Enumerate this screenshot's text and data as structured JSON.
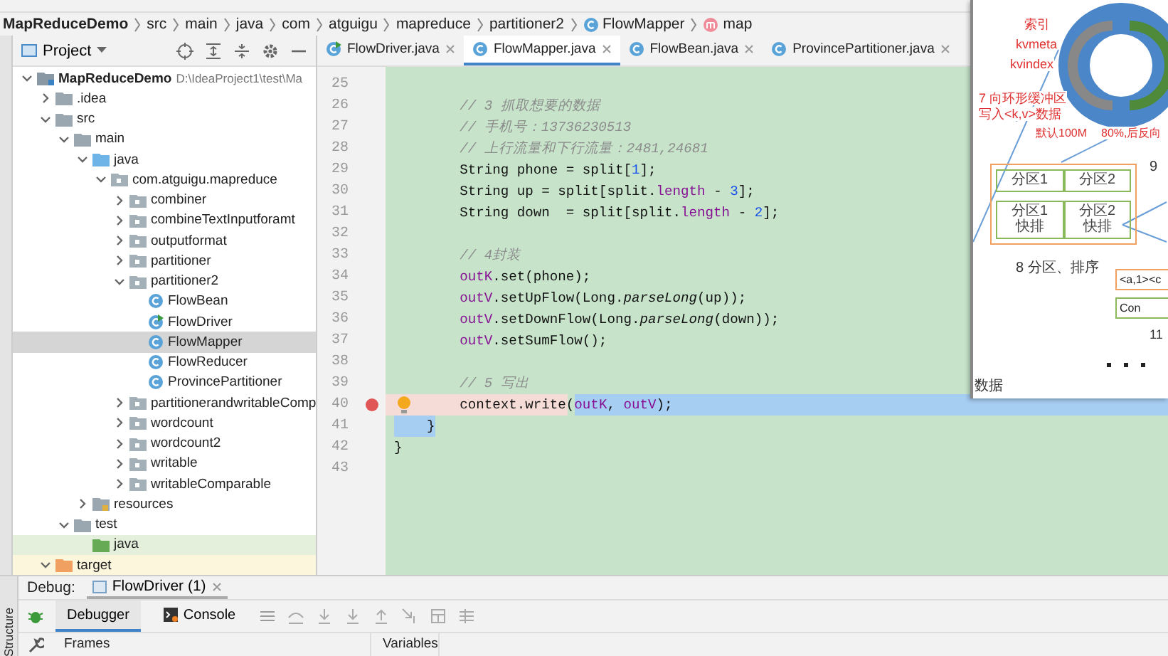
{
  "breadcrumbs": [
    {
      "text": "MapReduceDemo",
      "kind": "project"
    },
    {
      "text": "src",
      "kind": "folder"
    },
    {
      "text": "main",
      "kind": "folder"
    },
    {
      "text": "java",
      "kind": "folder"
    },
    {
      "text": "com",
      "kind": "folder"
    },
    {
      "text": "atguigu",
      "kind": "folder"
    },
    {
      "text": "mapreduce",
      "kind": "folder"
    },
    {
      "text": "partitioner2",
      "kind": "folder"
    },
    {
      "text": "FlowMapper",
      "kind": "class"
    },
    {
      "text": "map",
      "kind": "method"
    }
  ],
  "project_panel": {
    "title": "Project"
  },
  "tree": [
    {
      "label": "MapReduceDemo",
      "hint": "D:\\IdeaProject1\\test\\Ma",
      "kind": "module",
      "expanded": true,
      "selected": false,
      "children": [
        {
          "label": ".idea",
          "kind": "folder",
          "expanded": false,
          "selected": false
        },
        {
          "label": "src",
          "kind": "folder",
          "expanded": true,
          "selected": false,
          "children": [
            {
              "label": "main",
              "kind": "folder",
              "expanded": true,
              "selected": false,
              "children": [
                {
                  "label": "java",
                  "kind": "source",
                  "expanded": true,
                  "selected": false,
                  "children": [
                    {
                      "label": "com.atguigu.mapreduce",
                      "kind": "package",
                      "expanded": true,
                      "selected": false,
                      "children": [
                        {
                          "label": "combiner",
                          "kind": "package",
                          "expanded": false,
                          "selected": false
                        },
                        {
                          "label": "combineTextInputforamt",
                          "kind": "package",
                          "expanded": false,
                          "selected": false
                        },
                        {
                          "label": "outputformat",
                          "kind": "package",
                          "expanded": false,
                          "selected": false
                        },
                        {
                          "label": "partitioner",
                          "kind": "package",
                          "expanded": false,
                          "selected": false
                        },
                        {
                          "label": "partitioner2",
                          "kind": "package",
                          "expanded": true,
                          "selected": false,
                          "children": [
                            {
                              "label": "FlowBean",
                              "kind": "class",
                              "selected": false
                            },
                            {
                              "label": "FlowDriver",
                              "kind": "runnable-class",
                              "selected": false
                            },
                            {
                              "label": "FlowMapper",
                              "kind": "class",
                              "selected": true
                            },
                            {
                              "label": "FlowReducer",
                              "kind": "class",
                              "selected": false
                            },
                            {
                              "label": "ProvincePartitioner",
                              "kind": "class",
                              "selected": false
                            }
                          ]
                        },
                        {
                          "label": "partitionerandwritableComp",
                          "kind": "package",
                          "expanded": false,
                          "selected": false
                        },
                        {
                          "label": "wordcount",
                          "kind": "package",
                          "expanded": false,
                          "selected": false
                        },
                        {
                          "label": "wordcount2",
                          "kind": "package",
                          "expanded": false,
                          "selected": false
                        },
                        {
                          "label": "writable",
                          "kind": "package",
                          "expanded": false,
                          "selected": false
                        },
                        {
                          "label": "writableComparable",
                          "kind": "package",
                          "expanded": false,
                          "selected": false
                        }
                      ]
                    }
                  ]
                },
                {
                  "label": "resources",
                  "kind": "resources",
                  "expanded": false,
                  "selected": false
                }
              ]
            },
            {
              "label": "test",
              "kind": "folder",
              "expanded": true,
              "selected": false,
              "children": [
                {
                  "label": "java",
                  "kind": "test-source",
                  "selected": false
                }
              ]
            }
          ]
        },
        {
          "label": "target",
          "kind": "excluded",
          "expanded": true,
          "selected": false
        }
      ]
    }
  ],
  "editor_tabs": [
    {
      "label": "FlowDriver.java",
      "kind": "runnable-class",
      "selected": false
    },
    {
      "label": "FlowMapper.java",
      "kind": "class",
      "selected": true
    },
    {
      "label": "FlowBean.java",
      "kind": "class",
      "selected": false
    },
    {
      "label": "ProvincePartitioner.java",
      "kind": "class",
      "selected": false
    }
  ],
  "code_lines": [
    {
      "number": "25"
    },
    {
      "number": "26",
      "segments": [
        {
          "text": "        // 3 抓取想要的数据",
          "kind": "comment",
          "selected": false
        }
      ]
    },
    {
      "number": "27",
      "segments": [
        {
          "text": "        // 手机号：13736230513",
          "kind": "comment",
          "selected": false
        }
      ]
    },
    {
      "number": "28",
      "segments": [
        {
          "text": "        // 上行流量和下行流量：2481,24681",
          "kind": "comment",
          "selected": false
        }
      ]
    },
    {
      "number": "29",
      "segments": [
        {
          "text": "        String phone = split[",
          "kind": "plain",
          "selected": false
        },
        {
          "text": "1",
          "kind": "number",
          "selected": false
        },
        {
          "text": "];",
          "kind": "plain",
          "selected": false
        }
      ]
    },
    {
      "number": "30",
      "segments": [
        {
          "text": "        String up = split[split.",
          "kind": "plain",
          "selected": false
        },
        {
          "text": "length",
          "kind": "field",
          "selected": false
        },
        {
          "text": " - ",
          "kind": "plain",
          "selected": false
        },
        {
          "text": "3",
          "kind": "number",
          "selected": false
        },
        {
          "text": "];",
          "kind": "plain",
          "selected": false
        }
      ]
    },
    {
      "number": "31",
      "segments": [
        {
          "text": "        String down  = split[split.",
          "kind": "plain",
          "selected": false
        },
        {
          "text": "length",
          "kind": "field",
          "selected": false
        },
        {
          "text": " - ",
          "kind": "plain",
          "selected": false
        },
        {
          "text": "2",
          "kind": "number",
          "selected": false
        },
        {
          "text": "];",
          "kind": "plain",
          "selected": false
        }
      ]
    },
    {
      "number": "32"
    },
    {
      "number": "33",
      "segments": [
        {
          "text": "        // 4封装",
          "kind": "comment",
          "selected": false
        }
      ]
    },
    {
      "number": "34",
      "segments": [
        {
          "text": "        outK",
          "kind": "field",
          "selected": false
        },
        {
          "text": ".set(phone);",
          "kind": "plain",
          "selected": false
        }
      ]
    },
    {
      "number": "35",
      "segments": [
        {
          "text": "        outV",
          "kind": "field",
          "selected": false
        },
        {
          "text": ".setUpFlow(Long.",
          "kind": "plain",
          "selected": false
        },
        {
          "text": "parseLong",
          "kind": "static",
          "selected": false
        },
        {
          "text": "(up));",
          "kind": "plain",
          "selected": false
        }
      ]
    },
    {
      "number": "36",
      "segments": [
        {
          "text": "        outV",
          "kind": "field",
          "selected": false
        },
        {
          "text": ".setDownFlow(Long.",
          "kind": "plain",
          "selected": false
        },
        {
          "text": "parseLong",
          "kind": "static",
          "selected": false
        },
        {
          "text": "(down));",
          "kind": "plain",
          "selected": false
        }
      ]
    },
    {
      "number": "37",
      "segments": [
        {
          "text": "        outV",
          "kind": "field",
          "selected": false
        },
        {
          "text": ".setSumFlow();",
          "kind": "plain",
          "selected": false
        }
      ]
    },
    {
      "number": "38"
    },
    {
      "number": "39",
      "segments": [
        {
          "text": "        // 5 写出",
          "kind": "comment",
          "selected": false
        }
      ]
    },
    {
      "number": "40",
      "breakpoint": true,
      "bulb": true,
      "segments": [
        {
          "text": "        context.write(",
          "kind": "plain",
          "selected": false
        },
        {
          "text": "outK",
          "kind": "field",
          "selected": true
        },
        {
          "text": ", ",
          "kind": "plain",
          "selected": true
        },
        {
          "text": "outV",
          "kind": "field",
          "selected": true
        },
        {
          "text": ");",
          "kind": "plain",
          "selected": true
        }
      ]
    },
    {
      "number": "41",
      "segments": [
        {
          "text": "    }",
          "kind": "plain",
          "selected": true
        }
      ]
    },
    {
      "number": "42",
      "segments": [
        {
          "text": "}",
          "kind": "plain",
          "selected": false
        }
      ]
    },
    {
      "number": "43"
    }
  ],
  "diagram": {
    "ring_labels": [
      "索引",
      "kvmeta",
      "kvindex"
    ],
    "write_note": [
      "7 向环形缓冲区",
      "写入<k,v>数据"
    ],
    "size_note": "默认100M",
    "spill_note": "80%,后反向",
    "partition_rows": [
      [
        {
          "lines": [
            "分区1"
          ]
        },
        {
          "lines": [
            "分区2"
          ]
        }
      ],
      [
        {
          "lines": [
            "分区1",
            "快排"
          ]
        },
        {
          "lines": [
            "分区2",
            "快排"
          ]
        }
      ]
    ],
    "step_spill": "9",
    "step_sort": "8 分区、排序",
    "kv_box": "<a,1><c",
    "combine_box": "Con",
    "step_merge": "11",
    "bottom_text": "数据"
  },
  "debug": {
    "label": "Debug:",
    "session_tab": "FlowDriver (1)",
    "tabs": [
      {
        "label": "Debugger",
        "selected": true
      },
      {
        "label": "Console",
        "selected": false
      }
    ],
    "columns": [
      "Frames",
      "Variables"
    ]
  },
  "side_label": "Structure"
}
